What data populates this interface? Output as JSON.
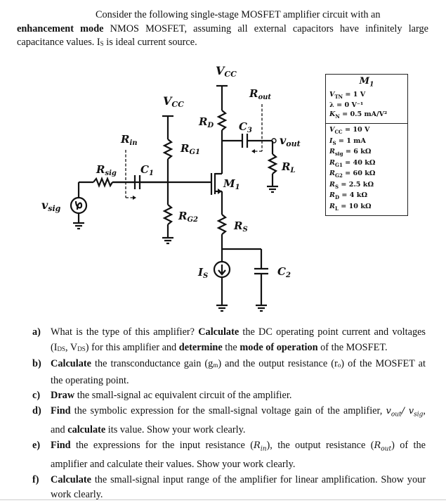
{
  "intro": {
    "part1": "Consider the following single-stage MOSFET amplifier circuit with an",
    "bold1": "enhancement mode",
    "part2": " NMOS MOSFET, assuming all external capacitors have infinitely large capacitance values. I",
    "sub_s": "S",
    "part3": " is ideal current source."
  },
  "circuit": {
    "labels": {
      "vcc_left": "V",
      "vcc_left_sub": "CC",
      "vcc_right": "V",
      "vcc_right_sub": "CC",
      "rin": "R",
      "rin_sub": "in",
      "rout": "R",
      "rout_sub": "out",
      "rsig": "R",
      "rsig_sub": "sig",
      "c1": "C",
      "c1_sub": "1",
      "rg1": "R",
      "rg1_sub": "G1",
      "rg2": "R",
      "rg2_sub": "G2",
      "rd": "R",
      "rd_sub": "D",
      "c3": "C",
      "c3_sub": "3",
      "vout": "v",
      "vout_sub": "out",
      "rl": "R",
      "rl_sub": "L",
      "m1": "M",
      "m1_sub": "1",
      "rs": "R",
      "rs_sub": "S",
      "is": "I",
      "is_sub": "S",
      "c2": "C",
      "c2_sub": "2",
      "vsig": "v",
      "vsig_sub": "sig"
    }
  },
  "params": {
    "title": "M",
    "title_sub": "1",
    "device": [
      {
        "sym": "V",
        "sub": "TN",
        "val": " = 1 V"
      },
      {
        "sym": "λ",
        "sub": "",
        "val": " = 0 V⁻¹"
      },
      {
        "sym": "K",
        "sub": "N",
        "val": " = 0.5 mA/V²"
      }
    ],
    "circuit": [
      {
        "sym": "V",
        "sub": "CC",
        "val": " = 10 V"
      },
      {
        "sym": "I",
        "sub": "S",
        "val": " = 1 mA"
      },
      {
        "sym": "R",
        "sub": "sig",
        "val": " = 6 kΩ"
      },
      {
        "sym": "R",
        "sub": "G1",
        "val": " = 40 kΩ"
      },
      {
        "sym": "R",
        "sub": "G2",
        "val": " = 60 kΩ"
      },
      {
        "sym": "R",
        "sub": "S",
        "val": " = 2.5 kΩ"
      },
      {
        "sym": "R",
        "sub": "D",
        "val": " = 4 kΩ"
      },
      {
        "sym": "R",
        "sub": "L",
        "val": " = 10 kΩ"
      }
    ]
  },
  "questions": {
    "a": {
      "label": "a)",
      "t1": "What is the type of this amplifier? ",
      "b1": "Calculate",
      "t2": " the DC operating point current and voltages (I",
      "s1": "DS",
      "t3": ", V",
      "s2": "DS",
      "t4": ") for this amplifier and ",
      "b2": "determine",
      "t5": " the ",
      "b3": "mode of operation",
      "t6": " of the MOSFET."
    },
    "b": {
      "label": "b)",
      "b1": "Calculate",
      "t1": " the transconductance gain (g",
      "s1": "m",
      "t2": ") and the output resistance (r",
      "s2": "o",
      "t3": ") of the MOSFET at the operating point."
    },
    "c": {
      "label": "c)",
      "b1": "Draw",
      "t1": " the small-signal ac equivalent circuit of the amplifier."
    },
    "d": {
      "label": "d)",
      "b1": "Find",
      "t1": " the symbolic expression for the small-signal voltage gain of the amplifier, ",
      "m1": "v",
      "m1s": "out",
      "m2": "/ v",
      "m2s": "sig",
      "t2": ", and ",
      "b2": "calculate",
      "t3": " its value. Show your work clearly."
    },
    "e": {
      "label": "e)",
      "b1": "Find",
      "t1": " the expressions for the input resistance (",
      "m1": "R",
      "m1s": "in",
      "t2": "), the output resistance (",
      "m2": "R",
      "m2s": "out",
      "t3": ") of the amplifier and calculate their values. Show your work clearly."
    },
    "f": {
      "label": "f)",
      "b1": "Calculate",
      "t1": " the small-signal input range of the amplifier for linear amplification. Show your work clearly."
    }
  }
}
